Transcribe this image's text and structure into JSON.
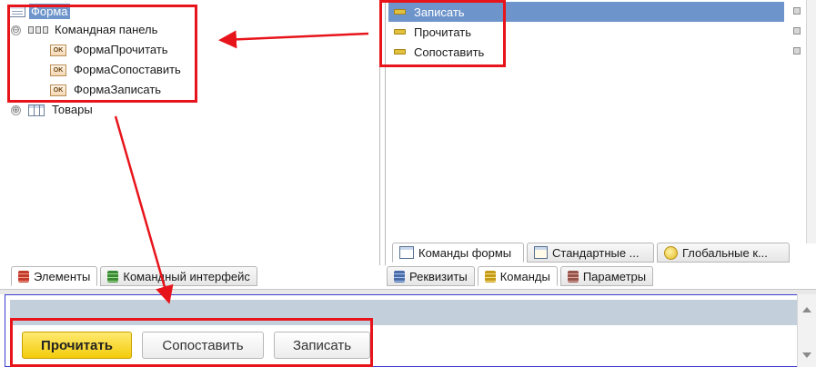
{
  "left_tree": {
    "root_label": "Форма",
    "items": [
      {
        "label": "Командная панель",
        "icon": "command-bar-icon",
        "expander": "⊖"
      },
      {
        "label": "ФормаПрочитать",
        "icon": "ok-button-icon",
        "badge": "OK"
      },
      {
        "label": "ФормаСопоставить",
        "icon": "ok-button-icon",
        "badge": "OK"
      },
      {
        "label": "ФормаЗаписать",
        "icon": "ok-button-icon",
        "badge": "OK"
      },
      {
        "label": "Товары",
        "icon": "table-icon",
        "expander": "⊕"
      }
    ]
  },
  "left_tabs": [
    {
      "label": "Элементы",
      "active": true
    },
    {
      "label": "Командный интерфейс",
      "active": false
    }
  ],
  "form_commands": [
    {
      "label": "Записать",
      "selected": true
    },
    {
      "label": "Прочитать",
      "selected": false
    },
    {
      "label": "Сопоставить",
      "selected": false
    }
  ],
  "command_type_tabs": [
    {
      "label": "Команды формы",
      "active": true
    },
    {
      "label": "Стандартные ...",
      "active": false
    },
    {
      "label": "Глобальные к...",
      "active": false
    }
  ],
  "right_tabs": [
    {
      "label": "Реквизиты",
      "active": false
    },
    {
      "label": "Команды",
      "active": true
    },
    {
      "label": "Параметры",
      "active": false
    }
  ],
  "preview": {
    "buttons": [
      {
        "label": "Прочитать",
        "default": true
      },
      {
        "label": "Сопоставить",
        "default": false
      },
      {
        "label": "Записать",
        "default": false
      }
    ]
  },
  "colors": {
    "selection": "#6e95cb",
    "annotation_red": "#e8141b",
    "default_button": "#f3cc0b",
    "preview_border": "#3b3bd0"
  }
}
